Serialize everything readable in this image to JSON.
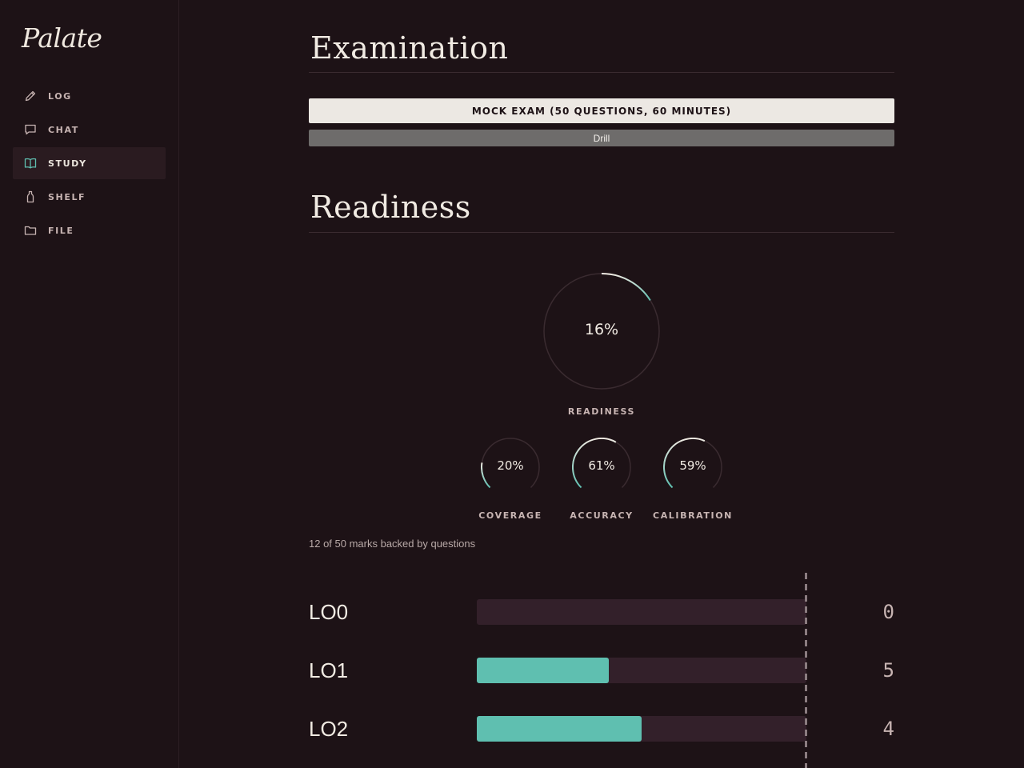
{
  "app": {
    "logo": "Palate"
  },
  "sidebar": {
    "items": [
      {
        "label": "LOG",
        "icon": "pencil-icon",
        "active": false
      },
      {
        "label": "CHAT",
        "icon": "chat-bubble-icon",
        "active": false
      },
      {
        "label": "STUDY",
        "icon": "open-book-icon",
        "active": true
      },
      {
        "label": "SHELF",
        "icon": "bottle-icon",
        "active": false
      },
      {
        "label": "FILE",
        "icon": "folder-icon",
        "active": false
      }
    ]
  },
  "examination": {
    "title": "Examination",
    "mock_button": "MOCK EXAM (50 QUESTIONS, 60 MINUTES)",
    "drill_button": "Drill"
  },
  "readiness": {
    "title": "Readiness",
    "main_gauge": {
      "label": "READINESS",
      "value_text": "16%",
      "value": 16
    },
    "sub_gauges": [
      {
        "label": "COVERAGE",
        "value_text": "20%",
        "value": 20
      },
      {
        "label": "ACCURACY",
        "value_text": "61%",
        "value": 61
      },
      {
        "label": "CALIBRATION",
        "value_text": "59%",
        "value": 59
      }
    ],
    "marks_note": "12 of 50 marks backed by questions"
  },
  "learning_objectives": {
    "max": 10,
    "rows": [
      {
        "name": "LO0",
        "count": "0",
        "value": 0
      },
      {
        "name": "LO1",
        "count": "5",
        "value": 4
      },
      {
        "name": "LO2",
        "count": "4",
        "value": 5
      }
    ]
  },
  "colors": {
    "background": "#1d1216",
    "accent": "#5fbfb0",
    "track": "#33202a",
    "primary_button": "#ece8e3",
    "secondary_button": "#6e6c6b"
  }
}
